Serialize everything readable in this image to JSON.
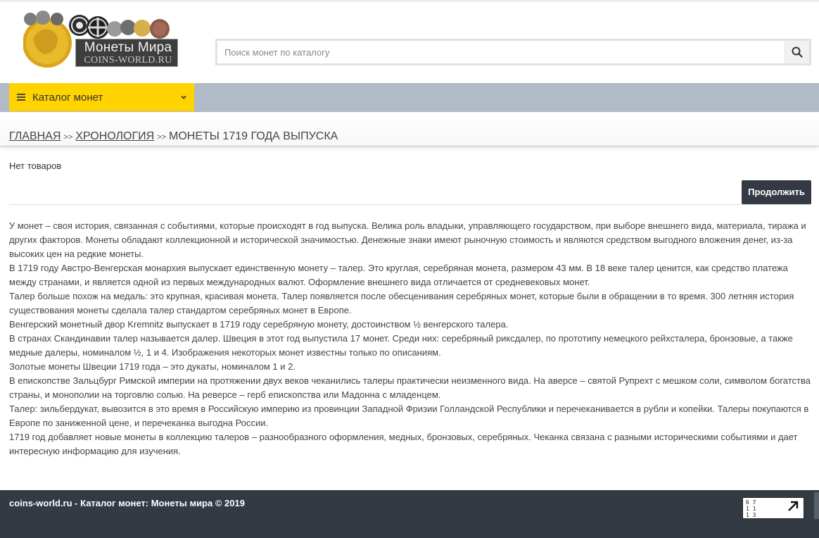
{
  "logo": {
    "title": "Монеты Мира",
    "subtitle": "COINS-WORLD.RU"
  },
  "search": {
    "placeholder": "Поиск монет по каталогу",
    "icon": "search-icon"
  },
  "nav": {
    "catalog_label": "Каталог монет"
  },
  "breadcrumb": {
    "items": [
      "ГЛАВНАЯ",
      "ХРОНОЛОГИЯ"
    ],
    "separator": ">>",
    "current": "МОНЕТЫ 1719 ГОДА ВЫПУСКА"
  },
  "content": {
    "empty_text": "Нет товаров",
    "continue_label": "Продолжить",
    "paragraphs": [
      "У монет – своя история, связанная с событиями, которые происходят в год выпуска. Велика роль владыки, управляющего государством, при выборе внешнего вида, материала, тиража и других факторов. Монеты обладают коллекционной и исторической значимостью. Денежные знаки имеют рыночную стоимость и являются средством выгодного вложения денег, из-за высоких цен на редкие монеты.",
      "В 1719 году Австро-Венгерская монархия выпускает единственную монету – талер. Это круглая, серебряная монета, размером 43 мм. В 18 веке талер ценится, как средство платежа между странами, и является одной из первых международных валют. Оформление внешнего вида отличается от средневековых монет.",
      "Талер больше похож на медаль: это крупная, красивая монета. Талер появляется после обесценивания серебряных монет, которые были в обращении в то время. 300 летняя история существования монеты сделала талер стандартом серебряных монет в Европе.",
      "Венгерский монетный двор Kremnitz выпускает в 1719 году серебряную монету, достоинством ½ венгерского талера.",
      "В странах Скандинавии талер называется далер. Швеция в этот год выпустила 17 монет. Среди них: серебряный риксдалер, по прототипу немецкого рейхсталера, бронзовые, а также медные далеры, номиналом ½, 1 и 4. Изображения некоторых монет известны только по описаниям.",
      "Золотые монеты Швеции 1719 года – это дукаты, номиналом 1 и 2.",
      "В епископстве Зальцбург Римской империи на протяжении двух веков чеканились талеры практически неизменного вида. На аверсе – святой Рупрехт с мешком соли, символом богатства страны, и монополии на торговлю солью. На реверсе – герб епископства или Мадонна с младенцем.",
      "Талер: зильбердукат, вывозится в это время в Российскую империю из провинции Западной Фризии Голландской Республики и перечеканивается в рубли и копейки. Талеры покупаются в Европе по заниженной цене, и перечеканка выгодна России.",
      "1719 год добавляет новые монеты в коллекцию талеров – разнообразного оформления, медных, бронзовых, серебряных. Чеканка связана с разными историческими событиями и дает интересную информацию для изучения."
    ]
  },
  "footer": {
    "text": "coins-world.ru - Каталог монет: Монеты мира © 2019",
    "counter_digits": [
      "6 7",
      "1 1",
      "1 3"
    ]
  },
  "colors": {
    "accent": "#ffd300",
    "nav_bg": "#b1bac7",
    "dark": "#333a44"
  }
}
